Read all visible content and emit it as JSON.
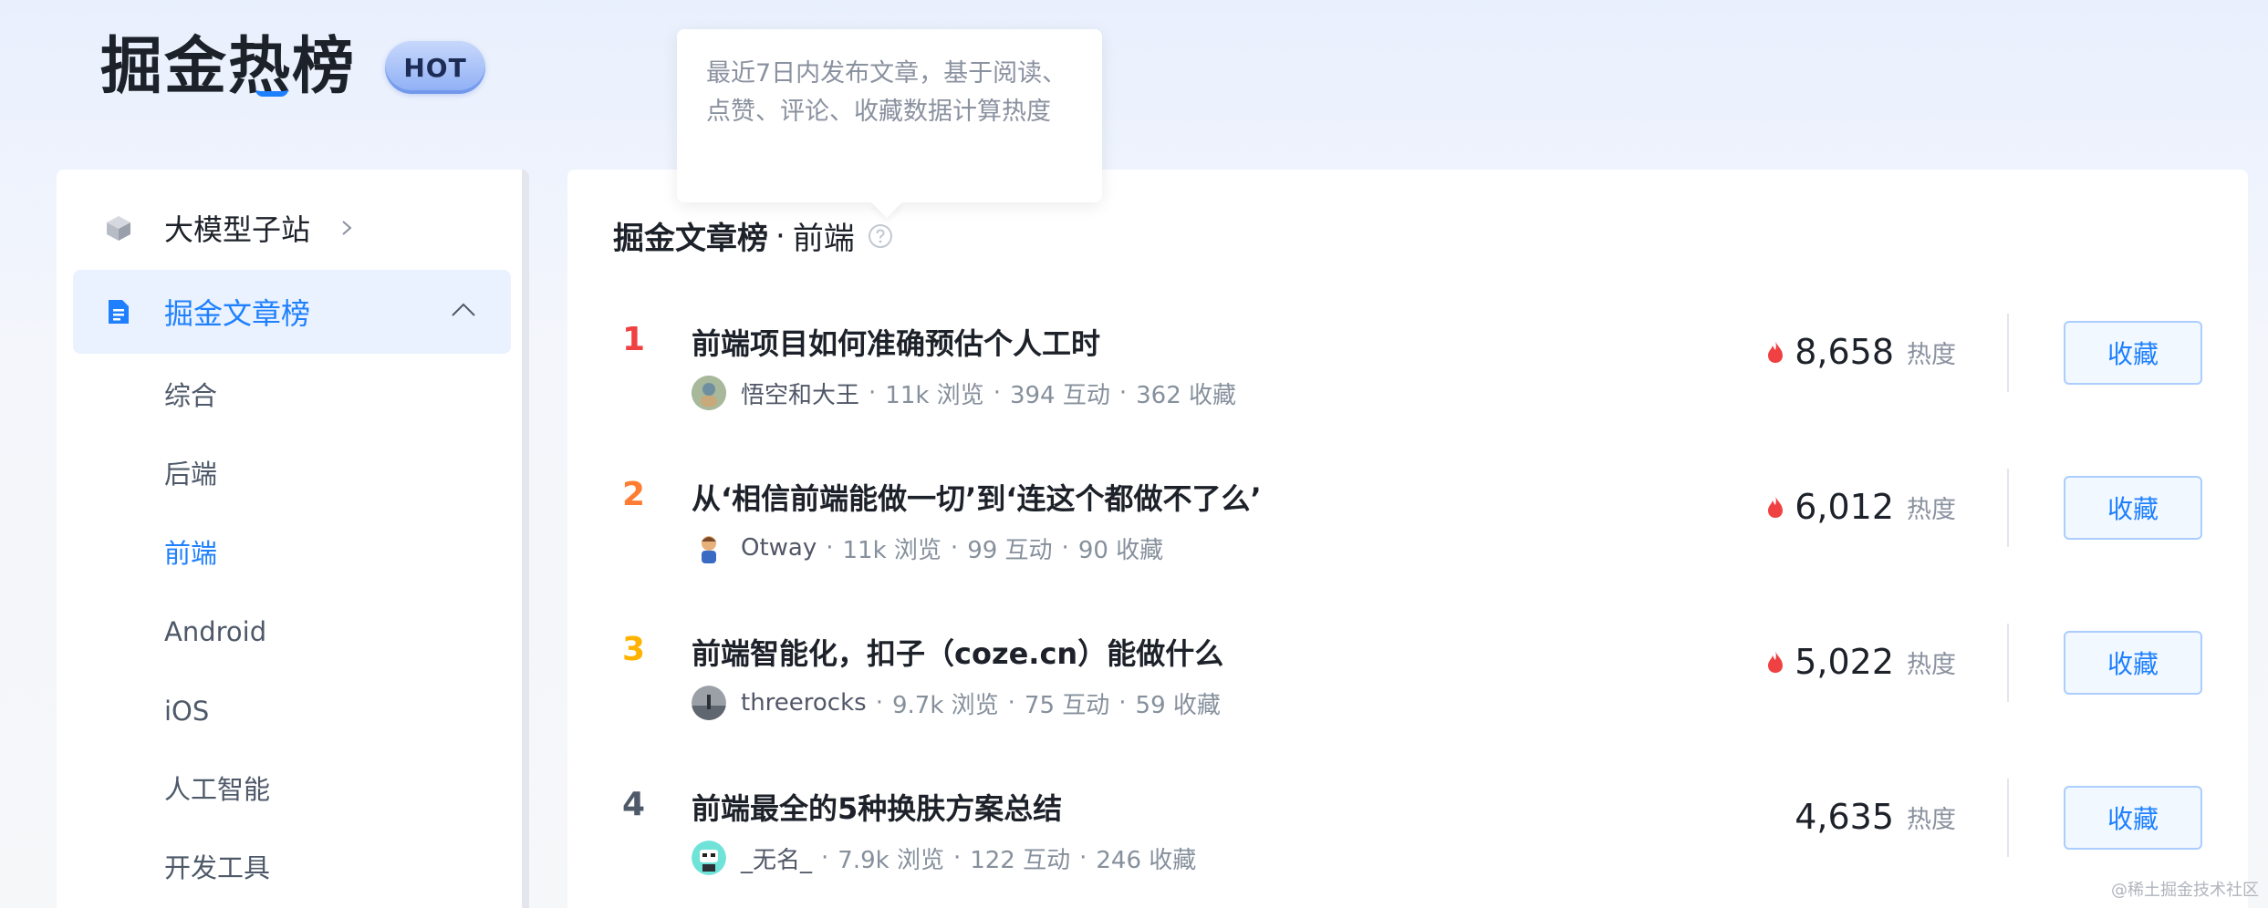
{
  "header": {
    "logo": "掘金热榜",
    "badge": "HOT"
  },
  "tooltip": {
    "text": "最近7日内发布文章，基于阅读、点赞、评论、收藏数据计算热度"
  },
  "sidebar": {
    "model_site": {
      "label": "大模型子站",
      "icon": "cube-icon"
    },
    "articles": {
      "label": "掘金文章榜",
      "icon": "document-icon"
    },
    "sub_items": [
      "综合",
      "后端",
      "前端",
      "Android",
      "iOS",
      "人工智能",
      "开发工具"
    ],
    "active_sub": "前端"
  },
  "main": {
    "title": "掘金文章榜",
    "separator": "·",
    "category": "前端",
    "heat_label": "热度",
    "fav_label": "收藏",
    "articles": [
      {
        "rank": "1",
        "title": "前端项目如何准确预估个人工时",
        "author": "悟空和大王",
        "views": "11k 浏览",
        "interactions": "394 互动",
        "favorites": "362 收藏",
        "heat": "8,658",
        "hot": true
      },
      {
        "rank": "2",
        "title": "从‘相信前端能做一切’到‘连这个都做不了么’",
        "author": "Otway",
        "views": "11k 浏览",
        "interactions": "99 互动",
        "favorites": "90 收藏",
        "heat": "6,012",
        "hot": true
      },
      {
        "rank": "3",
        "title": "前端智能化，扣子（coze.cn）能做什么",
        "author": "threerocks",
        "views": "9.7k 浏览",
        "interactions": "75 互动",
        "favorites": "59 收藏",
        "heat": "5,022",
        "hot": true
      },
      {
        "rank": "4",
        "title": "前端最全的5种换肤方案总结",
        "author": "_无名_",
        "views": "7.9k 浏览",
        "interactions": "122 互动",
        "favorites": "246 收藏",
        "heat": "4,635",
        "hot": false
      }
    ]
  },
  "watermark": "@稀土掘金技术社区",
  "colors": {
    "accent": "#1e80ff",
    "rank1": "#f04142",
    "rank2": "#ff7d33",
    "rank3": "#ffb300",
    "flame": "#f04142"
  }
}
